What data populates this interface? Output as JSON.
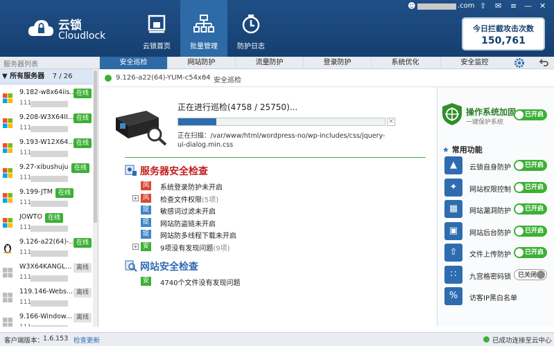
{
  "app": {
    "logo_cn": "云锁",
    "logo_en": "Cloudlock"
  },
  "header": {
    "nav": [
      {
        "label": "云锁首页",
        "icon": "home-monitor-icon"
      },
      {
        "label": "批量管理",
        "icon": "network-hierarchy-icon"
      },
      {
        "label": "防护日志",
        "icon": "clock-log-icon"
      }
    ],
    "user_domain_suffix": ".com",
    "attack_title": "今日拦截攻击次数",
    "attack_count": "150,761"
  },
  "tabbar": {
    "server_list_label": "服务器列表",
    "tabs": [
      "安全巡检",
      "网站防护",
      "流量防护",
      "登录防护",
      "系统优化",
      "安全监控"
    ]
  },
  "sidebar": {
    "header": "所有服务器",
    "count": "7 / 26",
    "servers": [
      {
        "name": "9.182-w8x64iis...",
        "ip": "111.",
        "status": "在线",
        "os": "windows"
      },
      {
        "name": "9.208-W3X64II...",
        "ip": "111.",
        "status": "在线",
        "os": "windows"
      },
      {
        "name": "9.193-W12X64...",
        "ip": "111.",
        "status": "在线",
        "os": "windows"
      },
      {
        "name": "9.27-xibushuju",
        "ip": "111.",
        "status": "在线",
        "os": "windows"
      },
      {
        "name": "9.199-JTM",
        "ip": "111.",
        "status": "在线",
        "os": "windows"
      },
      {
        "name": "JOWTO",
        "ip": "111.",
        "status": "在线",
        "os": "windows"
      },
      {
        "name": "9.126-a22(64)-...",
        "ip": "111.",
        "status": "在线",
        "os": "linux"
      },
      {
        "name": "W3X64KANGL...",
        "ip": "111.",
        "status": "离线",
        "os": "windows-gray"
      },
      {
        "name": "119.146-Webs...",
        "ip": "111.",
        "status": "离线",
        "os": "windows-gray"
      },
      {
        "name": "9.166-Window...",
        "ip": "111.",
        "status": "离线",
        "os": "windows-gray"
      }
    ]
  },
  "breadcrumb": {
    "server": "9.126-a22(64)-YUM-c54x64",
    "separator": ">",
    "page": "安全巡检"
  },
  "scan": {
    "title": "正在进行巡检(4758 / 25750)...",
    "progress": 0.185,
    "path": "正在扫描：/var/www/html/wordpress-no/wp-includes/css/jquery-ui-dialog.min.css",
    "cancel": "✕"
  },
  "server_check": {
    "title": "服务器安全检查",
    "items": [
      {
        "tag": "风险",
        "type": "risk",
        "text": "系统登录防护未开启",
        "extra": "",
        "expand": false
      },
      {
        "tag": "风险",
        "type": "risk",
        "text": "检查文件权限",
        "extra": "(5项)",
        "expand": true
      },
      {
        "tag": "提示",
        "type": "tip",
        "text": "敏感词过滤未开启",
        "extra": "",
        "expand": false
      },
      {
        "tag": "提示",
        "type": "tip",
        "text": "网站防盗链未开启",
        "extra": "",
        "expand": false
      },
      {
        "tag": "提示",
        "type": "tip",
        "text": "网站防多线程下载未开启",
        "extra": "",
        "expand": false
      },
      {
        "tag": "安全",
        "type": "safe",
        "text": "9项没有发现问题",
        "extra": "(9项)",
        "expand": true
      }
    ]
  },
  "web_check": {
    "title": "网站安全检查",
    "items": [
      {
        "tag": "安全",
        "type": "safe",
        "text": "4740个文件没有发现问题"
      }
    ]
  },
  "right_panel": {
    "os_hardening": {
      "title": "操作系统加固",
      "subtitle": "一键保护系统",
      "toggle": "已开启"
    },
    "common_header": "常用功能",
    "functions": [
      {
        "label": "云锁自身防护",
        "toggle": "已开启",
        "on": true,
        "icon": "shield-up-icon"
      },
      {
        "label": "网站权限控制",
        "toggle": "已开启",
        "on": true,
        "icon": "compass-icon"
      },
      {
        "label": "网站漏洞防护",
        "toggle": "已开启",
        "on": true,
        "icon": "puzzle-icon"
      },
      {
        "label": "网站后台防护",
        "toggle": "已开启",
        "on": true,
        "icon": "window-icon"
      },
      {
        "label": "文件上传防护",
        "toggle": "已开启",
        "on": true,
        "icon": "upload-icon"
      },
      {
        "label": "九宫格密码锁",
        "toggle": "已关闭",
        "on": false,
        "icon": "grid-lock-icon"
      },
      {
        "label": "访客IP黑白名单",
        "toggle": "",
        "on": false,
        "icon": "percent-icon"
      }
    ]
  },
  "footer": {
    "version_label": "客户端版本：",
    "version": "1.6.153",
    "check_update": "检查更新",
    "connection": "已成功连接至云中心"
  },
  "colors": {
    "header": "#1f4f86",
    "accent": "#2e6cb0",
    "ok": "#3cb035",
    "risk": "#d94a3a"
  }
}
